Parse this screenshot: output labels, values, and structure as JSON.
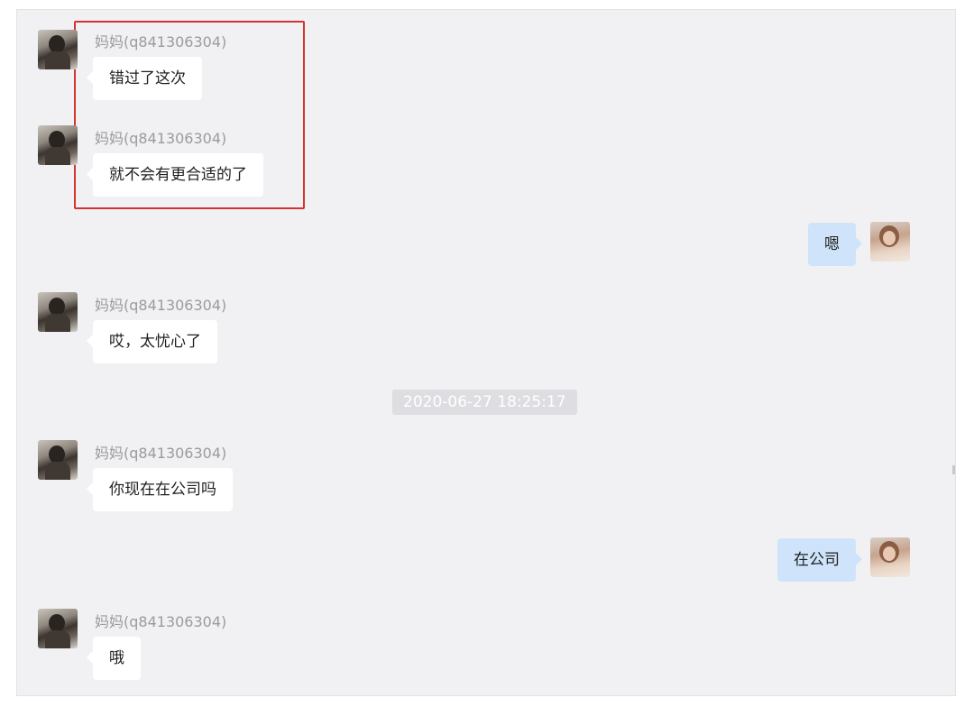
{
  "timestamp": "2020-06-27 18:25:17",
  "messages": [
    {
      "from": "mom",
      "sender": "妈妈(q841306304)",
      "text": "错过了这次"
    },
    {
      "from": "mom",
      "sender": "妈妈(q841306304)",
      "text": "就不会有更合适的了"
    },
    {
      "from": "me",
      "text": "嗯"
    },
    {
      "from": "mom",
      "sender": "妈妈(q841306304)",
      "text": "哎，太忧心了"
    },
    {
      "from": "mom",
      "sender": "妈妈(q841306304)",
      "text": "你现在在公司吗"
    },
    {
      "from": "me",
      "text": "在公司"
    },
    {
      "from": "mom",
      "sender": "妈妈(q841306304)",
      "text": "哦"
    }
  ],
  "colors": {
    "highlight_box": "#d3342f",
    "own_bubble": "#cfe4fb",
    "other_bubble": "#ffffff",
    "chat_background": "#f1f1f3"
  }
}
